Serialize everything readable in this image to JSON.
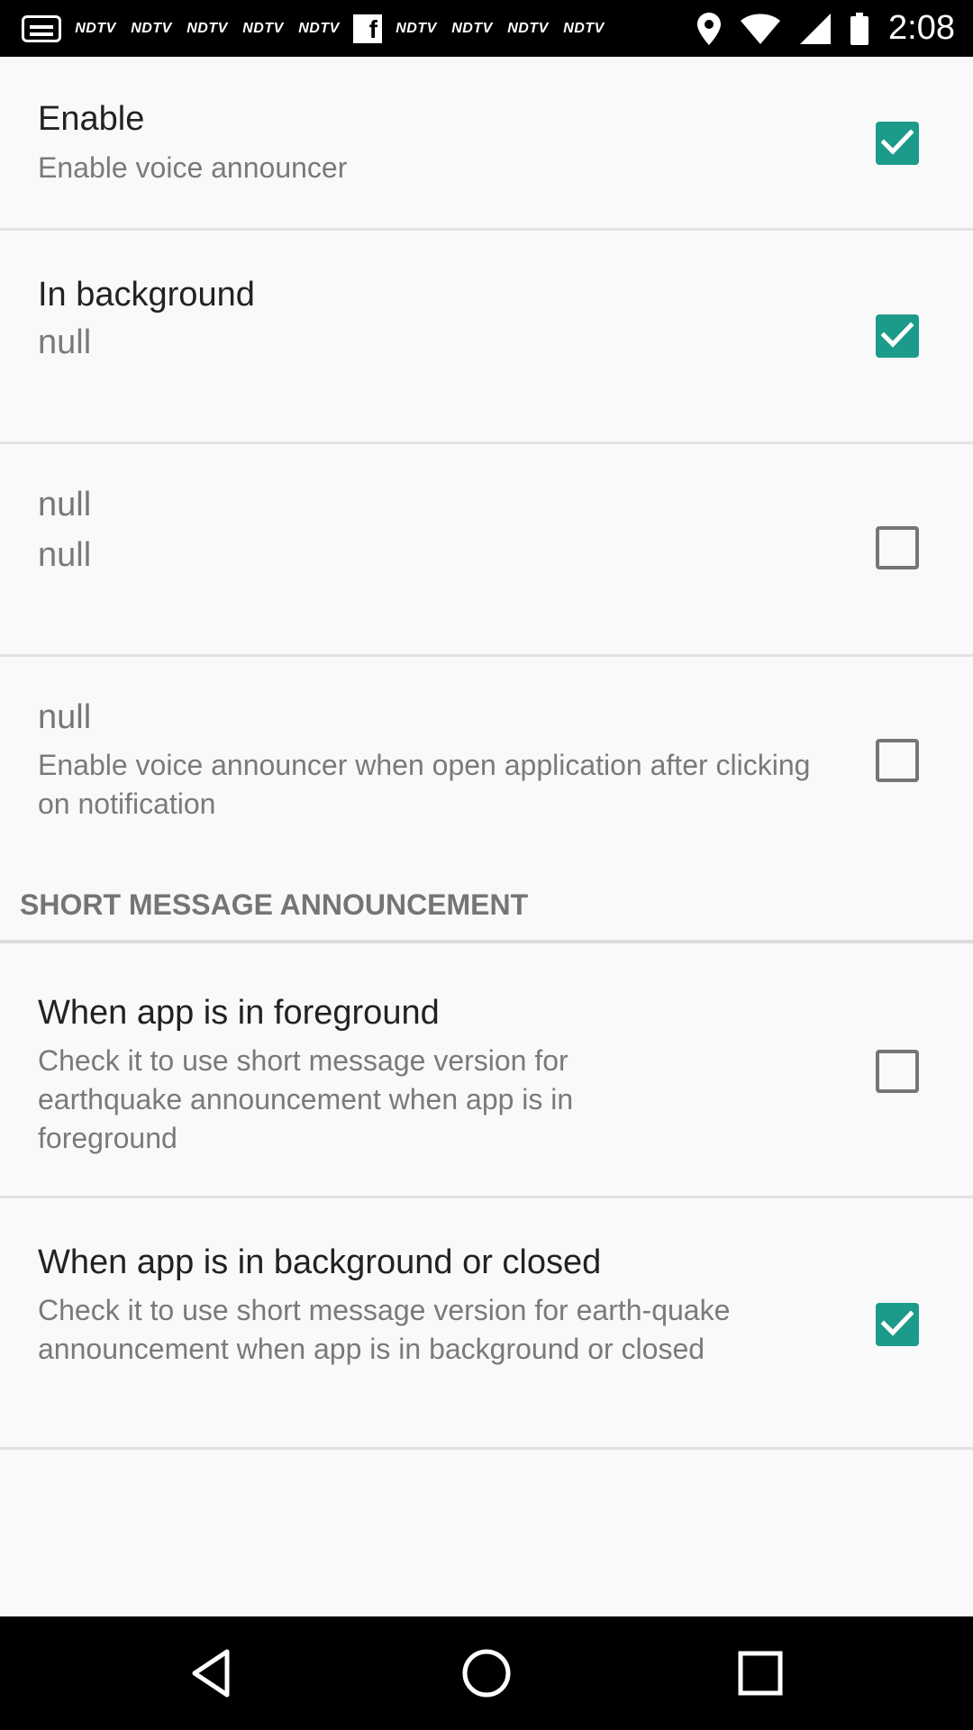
{
  "status_bar": {
    "time": "2:08",
    "notification_labels": [
      "NDTV",
      "NDTV",
      "NDTV",
      "NDTV",
      "NDTV",
      "NDTV",
      "NDTV",
      "NDTV",
      "NDTV"
    ],
    "facebook_glyph": "f",
    "icons": [
      "message-icon",
      "facebook-icon",
      "location-icon",
      "wifi-icon",
      "signal-icon",
      "battery-icon"
    ]
  },
  "preferences": [
    {
      "title": "Enable",
      "summary": "Enable voice announcer",
      "checked": true
    },
    {
      "title": "In background",
      "summary": "null",
      "checked": true
    },
    {
      "title": "null",
      "summary": "null",
      "checked": false
    },
    {
      "title": "null",
      "summary": "Enable voice announcer when open application after clicking on notification",
      "checked": false
    }
  ],
  "section": {
    "header": "SHORT MESSAGE ANNOUNCEMENT",
    "items": [
      {
        "title": "When app is in foreground",
        "summary": "Check it to use short message version for earthquake announcement when app is in foreground",
        "checked": false
      },
      {
        "title": "When app is in background or closed",
        "summary": "Check it to use short message version for earth-quake announcement when app is in background or closed",
        "checked": true
      }
    ]
  },
  "colors": {
    "accent": "#1d9b8a",
    "checkbox_border": "#757575",
    "background": "#f9f9f9"
  },
  "nav_bar": {
    "icons": [
      "back-icon",
      "home-icon",
      "recents-icon"
    ]
  }
}
